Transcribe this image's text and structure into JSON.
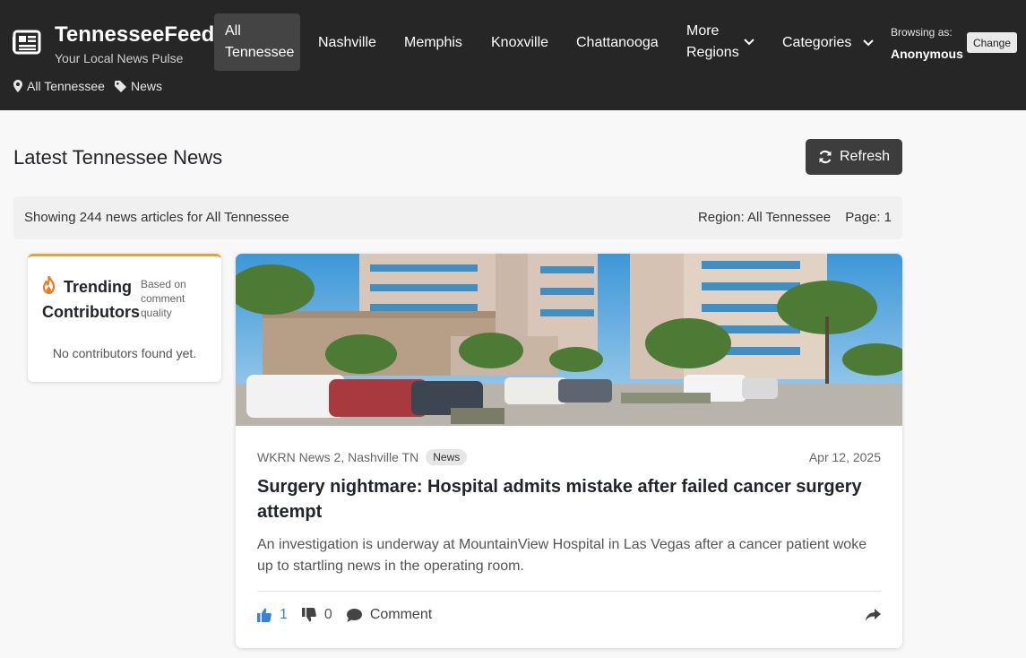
{
  "brand": {
    "name": "TennesseeFeeds",
    "tagline": "Your Local News Pulse"
  },
  "nav": {
    "active": "All Tennessee",
    "items": [
      "Nashville",
      "Memphis",
      "Knoxville",
      "Chattanooga"
    ],
    "more": "More Regions",
    "categories": "Categories"
  },
  "user": {
    "browsing_label": "Browsing as:",
    "name": "Anonymous",
    "change_label": "Change"
  },
  "breadcrumb": {
    "region": "All Tennessee",
    "category": "News"
  },
  "main": {
    "title": "Latest Tennessee News",
    "refresh_label": "Refresh",
    "info": {
      "summary": "Showing 244 news articles for All Tennessee",
      "region": "Region: All Tennessee",
      "page": "Page: 1"
    }
  },
  "trending": {
    "title": "Trending Contributors",
    "note": "Based on comment quality",
    "empty": "No contributors found yet."
  },
  "article": {
    "source": "WKRN News 2, Nashville TN",
    "tag": "News",
    "date": "Apr 12, 2025",
    "title": "Surgery nightmare: Hospital admits mistake after failed cancer surgery attempt",
    "summary": "An investigation is underway at MountainView Hospital in Las Vegas after a cancer patient woke up to startling news in the operating room.",
    "likes": "1",
    "dislikes": "0",
    "comment_label": "Comment"
  },
  "colors": {
    "header_bg": "#262626",
    "accent_like": "#3b82d6",
    "trend_border": "#f0a030",
    "flame": "#f07820"
  }
}
